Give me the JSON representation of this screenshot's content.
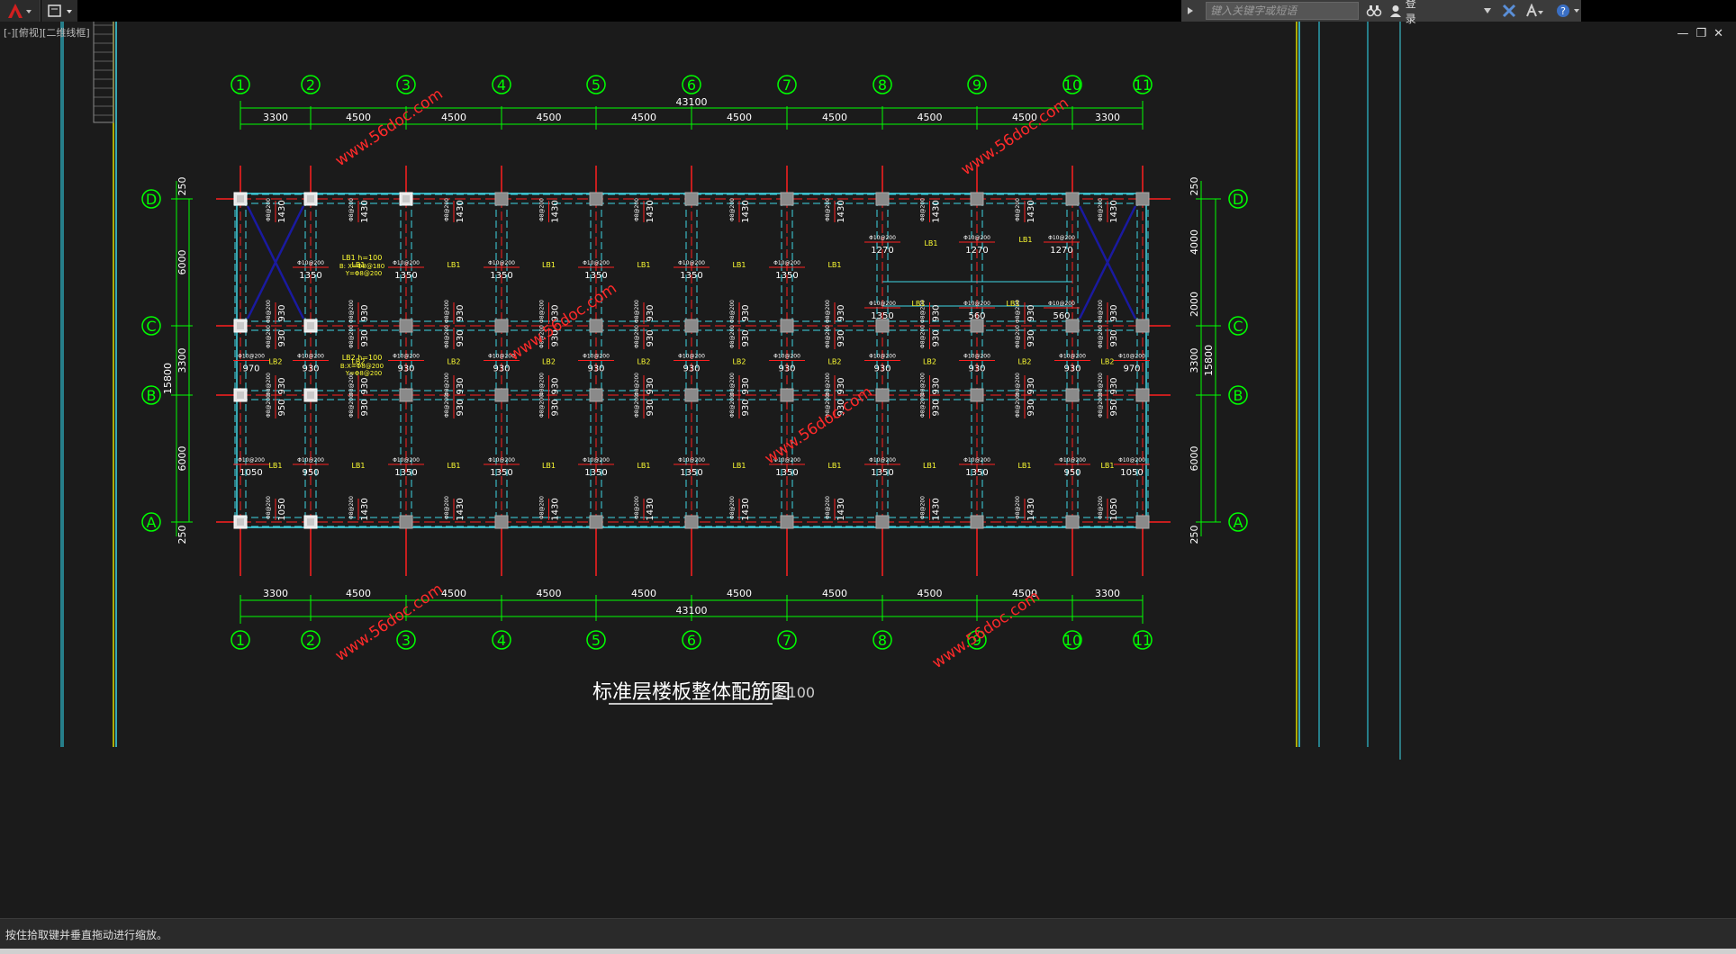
{
  "app": {
    "search_placeholder": "键入关键字或短语",
    "login_label": "登录",
    "viewport_label": "[-][俯视][二维线框]",
    "status_text": "按住拾取键并垂直拖动进行缩放。"
  },
  "drawing": {
    "title": "标准层楼板整体配筋图",
    "scale": "1:100",
    "total_length": "43100",
    "total_width": "15800",
    "column_labels": [
      "1",
      "2",
      "3",
      "4",
      "5",
      "6",
      "7",
      "8",
      "9",
      "10",
      "11"
    ],
    "bay_spacings": [
      "3300",
      "4500",
      "4500",
      "4500",
      "4500",
      "4500",
      "4500",
      "4500",
      "4500",
      "3300"
    ],
    "row_labels": [
      "D",
      "C",
      "B",
      "A"
    ],
    "left_dims": [
      "250",
      "6000",
      "3300",
      "6000",
      "250"
    ],
    "right_dims": [
      "250",
      "4000",
      "2000",
      "3300",
      "6000",
      "250"
    ],
    "slab_notes": {
      "lb1": "LB1  h=100",
      "lb1_b": "B: X=Φ8@180",
      "lb1_y": "Y=Φ8@200",
      "lb2": "LB2  h=100",
      "lb2_b": "B:X=Φ8@200",
      "lb2_y": "Y=Φ8@200"
    },
    "labels": {
      "lb1": "LB1",
      "lb2": "LB2",
      "r1350": "1350",
      "r1430": "1430",
      "r930": "930",
      "r950": "950",
      "r970": "970",
      "r1050": "1050",
      "r1270": "1270",
      "r560": "560",
      "rebar1": "Φ10@200",
      "rebar2": "Φ8@200"
    },
    "watermark": "www.56doc.com"
  },
  "colors": {
    "grid": "#00ff00",
    "axis_red": "#ff2020",
    "beam_cyan": "#3fd7e6",
    "text_white": "#ffffff",
    "note_yellow": "#ffff33",
    "watermark": "#ff2a2a",
    "brace_blue": "#1a1aa0"
  }
}
